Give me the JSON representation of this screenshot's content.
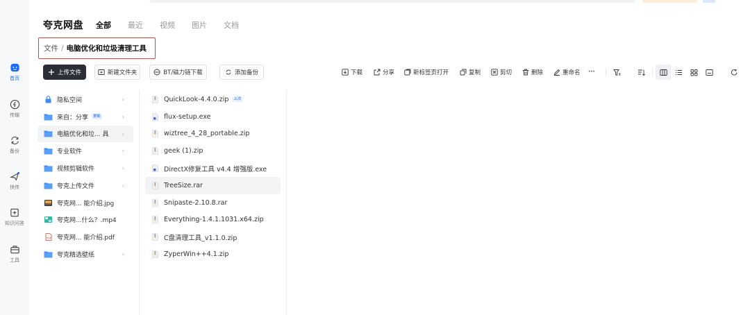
{
  "sidebar": {
    "items": [
      {
        "label": "首页",
        "icon": "home-icon",
        "active": true
      },
      {
        "label": "传输",
        "icon": "transfer-icon"
      },
      {
        "label": "备份",
        "icon": "backup-icon"
      },
      {
        "label": "快传",
        "icon": "quick-send-icon"
      },
      {
        "label": "知识问答",
        "icon": "qa-icon"
      },
      {
        "label": "工具",
        "icon": "toolbox-icon"
      }
    ]
  },
  "header": {
    "brand": "夸克网盘",
    "tabs": [
      {
        "label": "全部",
        "active": true
      },
      {
        "label": "最近"
      },
      {
        "label": "视频"
      },
      {
        "label": "图片"
      },
      {
        "label": "文档"
      }
    ]
  },
  "breadcrumb": {
    "root": "文件",
    "separator": "/",
    "current": "电脑优化和垃圾清理工具"
  },
  "toolbar": {
    "upload": "上传文件",
    "new_folder": "新建文件夹",
    "bt_download": "BT/磁力链下载",
    "add_backup": "添加备份",
    "download": "下载",
    "share": "分享",
    "open_new_tab": "新标签页打开",
    "copy": "复制",
    "cut": "剪切",
    "delete": "删除",
    "rename": "重命名",
    "more": "···"
  },
  "folder_tree": [
    {
      "label": "隐私空间",
      "type": "lock",
      "arrow": true
    },
    {
      "label": "来自：分享",
      "type": "folder",
      "arrow": true,
      "badge": "更新"
    },
    {
      "label": "电脑优化和垃... 具",
      "type": "folder",
      "arrow": true,
      "selected": true
    },
    {
      "label": "专业软件",
      "type": "folder",
      "arrow": true
    },
    {
      "label": "视频剪辑软件",
      "type": "folder",
      "arrow": true
    },
    {
      "label": "夸克上传文件",
      "type": "folder",
      "arrow": true
    },
    {
      "label": "夸克网...  能介绍.jpg",
      "type": "image",
      "arrow": false
    },
    {
      "label": "夸克网...什么？.mp4",
      "type": "video",
      "arrow": false
    },
    {
      "label": "夸克网...  能介绍.pdf",
      "type": "pdf",
      "arrow": false
    },
    {
      "label": "夸克精选壁纸",
      "type": "folder",
      "arrow": true
    }
  ],
  "files": [
    {
      "name": "QuickLook-4.4.0.zip",
      "badge": "上次",
      "type": "zip"
    },
    {
      "name": "flux-setup.exe",
      "type": "exe"
    },
    {
      "name": "wiztree_4_28_portable.zip",
      "type": "zip"
    },
    {
      "name": "geek (1).zip",
      "type": "zip"
    },
    {
      "name": "DirectX修复工具 v4.4 增强版.exe",
      "type": "exe"
    },
    {
      "name": "TreeSize.rar",
      "type": "rar",
      "selected": true
    },
    {
      "name": "Snipaste-2.10.8.rar",
      "type": "rar"
    },
    {
      "name": "Everything-1.4.1.1031.x64.zip",
      "type": "zip"
    },
    {
      "name": "C盘清理工具_v1.1.0.zip",
      "type": "zip"
    },
    {
      "name": "ZyperWin++4.1.zip",
      "type": "zip"
    }
  ],
  "colors": {
    "accent": "#1a6cff",
    "primary_button": "#2b2e36",
    "folder": "#3d8bf6",
    "highlight_border": "#e0403a"
  }
}
